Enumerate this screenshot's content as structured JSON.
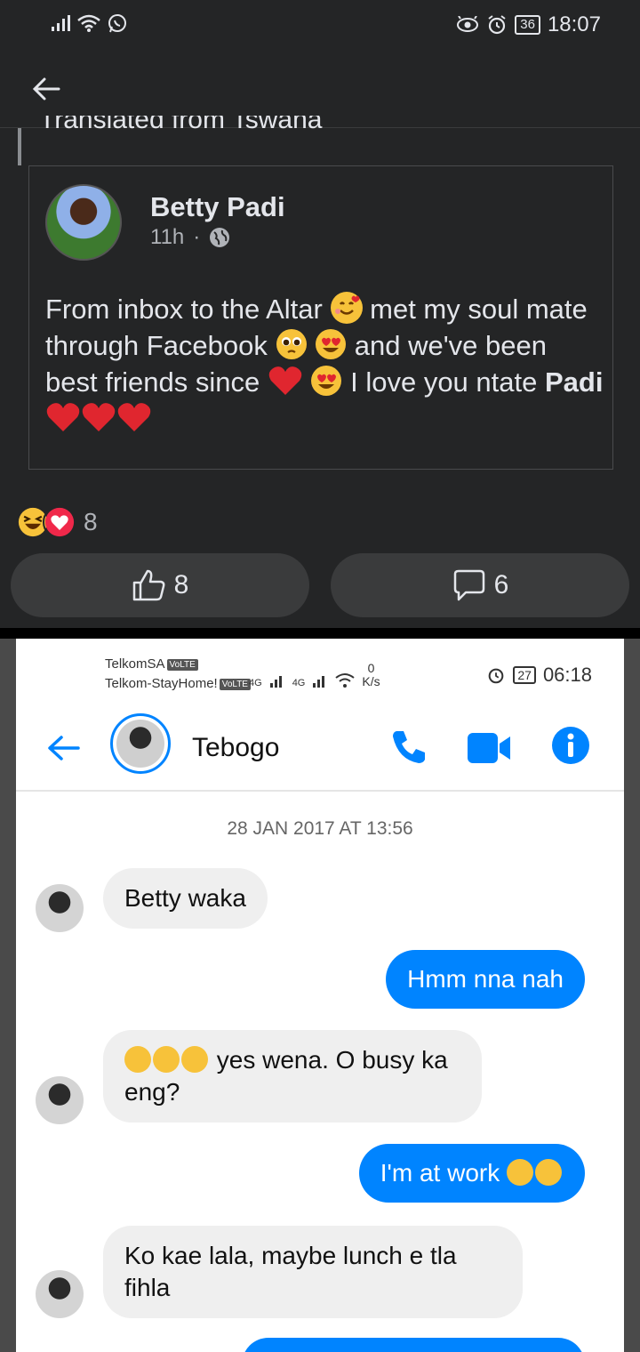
{
  "status_bar": {
    "time": "18:07",
    "battery": "36"
  },
  "post": {
    "translated_label": "Translated from Tswana",
    "author": "Betty Padi",
    "time": "11h",
    "text_parts": {
      "p1": "From inbox to the Altar",
      "p2": " met my soul mate through Facebook",
      "p3": " and we've been best friends since",
      "p4": " I love you ntate ",
      "p5_bold": "Padi"
    },
    "reaction_count": "8",
    "like_count": "8",
    "comment_count": "6"
  },
  "screenshot": {
    "status": {
      "carrier1": "TelkomSA",
      "carrier2": "Telkom-StayHome!",
      "volte": "VoLTE",
      "net1": "4G",
      "net2": "4G",
      "speed_value": "0",
      "speed_unit": "K/s",
      "battery": "27",
      "time": "06:18"
    },
    "contact_name": "Tebogo",
    "date": "28 JAN 2017 AT 13:56",
    "messages": [
      {
        "dir": "in",
        "text": "Betty waka"
      },
      {
        "dir": "out",
        "text": "Hmm nna nah"
      },
      {
        "dir": "in",
        "text": "yes wena. O busy ka eng?"
      },
      {
        "dir": "out",
        "text": "I'm at work"
      },
      {
        "dir": "in",
        "text": "Ko kae lala, maybe lunch e tla fihla"
      }
    ]
  },
  "colors": {
    "messenger_blue": "#0084ff",
    "dark_bg": "#242526",
    "heart_red": "#e0262f"
  }
}
